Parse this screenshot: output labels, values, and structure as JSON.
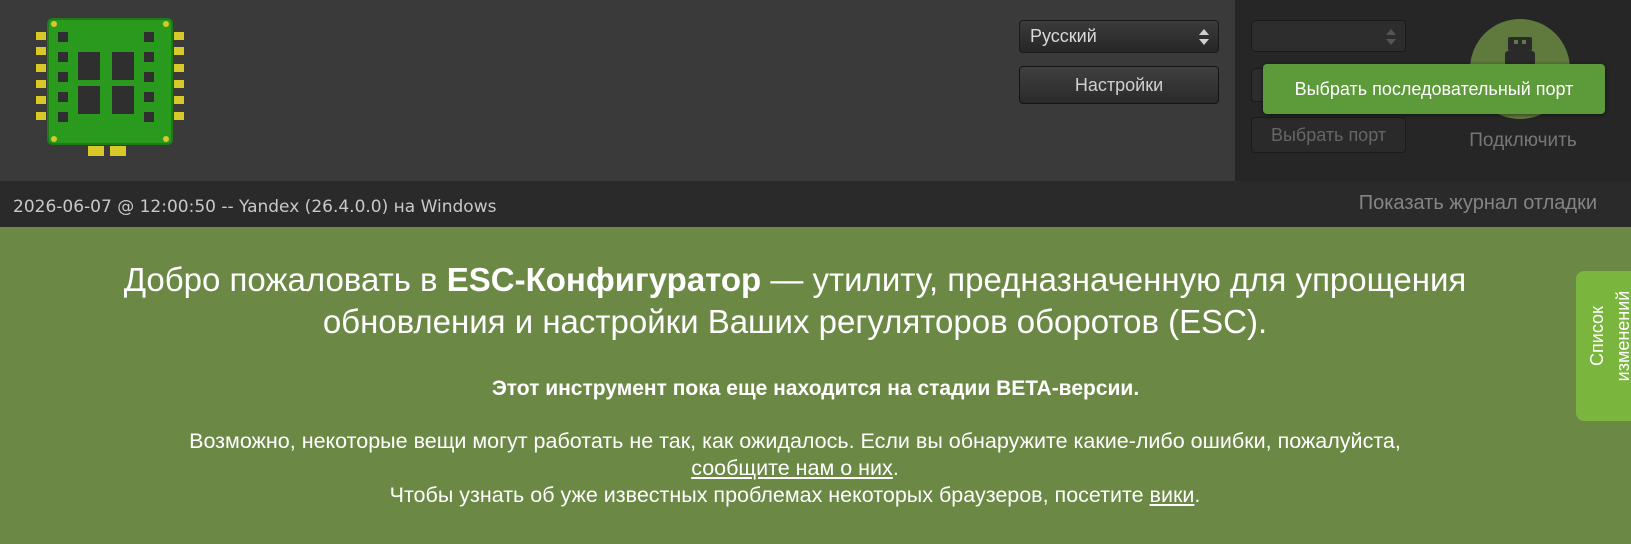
{
  "header": {
    "language_select": {
      "value": "Русский",
      "icon": "updown-arrows-icon"
    },
    "settings_button": {
      "label": "Настройки"
    },
    "port_panel": {
      "port_select": {
        "value": ""
      },
      "baud_select": {
        "value": ""
      },
      "select_port_button": {
        "label": "Выбрать порт"
      },
      "connect": {
        "label": "Подключить",
        "icon": "usb-icon"
      },
      "tooltip": {
        "text": "Выбрать последовательный порт"
      }
    }
  },
  "statusbar": {
    "info": "2026-06-07 @ 12:00:50 -- Yandex (26.4.0.0) на Windows",
    "debug_link": "Показать журнал отладки"
  },
  "content": {
    "welcome_pre": "Добро пожаловать в ",
    "welcome_bold": "ESC-Конфигуратор",
    "welcome_post": " — утилиту, предназначенную для упрощения обновления и настройки Ваших регуляторов оборотов (ESC).",
    "beta": "Этот инструмент пока еще находится на стадии BETA-версии.",
    "desc_line1": "Возможно, некоторые вещи могут работать не так, как ожидалось. Если вы обнаружите какие-либо ошибки, пожалуйста,",
    "report_link": "сообщите нам о них",
    "report_after": ".",
    "desc_line2": "Чтобы узнать об уже известных проблемах некоторых браузеров, посетите ",
    "wiki_link": "вики",
    "wiki_after": "."
  },
  "changelog_tab": {
    "label": "Список изменений"
  },
  "colors": {
    "accent": "#7ab53e",
    "background": "#6b8845",
    "header": "#3a3a3a",
    "tooltip": "#5d9a39"
  }
}
